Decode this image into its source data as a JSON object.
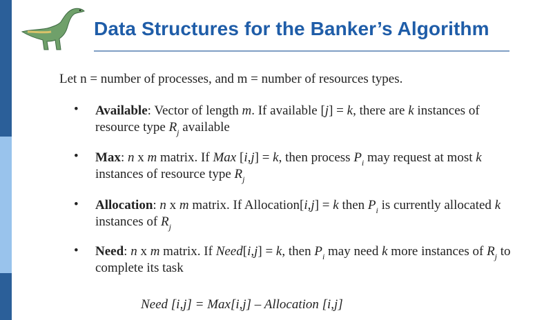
{
  "header": {
    "title": "Data Structures for the Banker’s Algorithm"
  },
  "intro": "Let n = number of processes, and m = number of resources types.",
  "formula": "Need [i,j] = Max[i,j] – Allocation [i,j]",
  "colors": {
    "title": "#1f5da8",
    "sidebar_dark": "#2b5f99",
    "sidebar_light": "#99c3ec"
  },
  "icons": [
    "dinosaur-logo-icon",
    "bullet-icon"
  ]
}
